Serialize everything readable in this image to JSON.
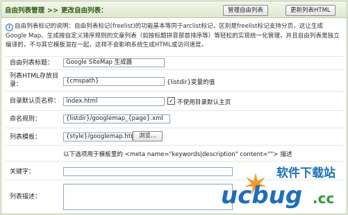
{
  "header": {
    "crumb_root": "自由列表管理",
    "crumb_separator": ">>",
    "crumb_current": "更改自由列表：",
    "manage_button": "管理自由列表",
    "update_button": "更新列表HTML"
  },
  "intro": {
    "text": "自由列表标记的说明：自由列表标记(freelist)的功能基本等同于arclist标记，区别是freelist标记支持分页，这让生成Google Map、生成按自定义排序规则的文章列表（如按标题拼音部首排序等）等轻松的实现统一化管理，并且自由列表是独立编译的，不与其它模板混在一起，这样不会影响系统生成HTML或访问速度。"
  },
  "form": {
    "title_label": "自由列表标题：",
    "title_value": "Google SiteMap 生成器",
    "dir_label": "列表HTML存放目录：",
    "dir_value": "{cmspath}",
    "dir_note": "{listdir}变量的值",
    "default_page_label": "目录默认页名称：",
    "default_page_value": "index.html",
    "default_page_checkbox_label": "不使用目录默认主页",
    "naming_label": "命名规则：",
    "naming_value": "{listdir}/googlemap_{page}.xml",
    "template_label": "列表模板：",
    "template_value": "{style}/googlemap.htm",
    "browse_button": "浏览...",
    "meta_note": "以下选项用于模板里的 <meta name=\"keywords|description\" content=\"\"> 描述",
    "keywords_label": "关键字：",
    "keywords_value": "",
    "description_label": "列表描述：",
    "description_value": ""
  },
  "watermark": {
    "text_top": "软件下载站",
    "text_logo": "ucbug",
    "text_cc": ".cc"
  }
}
